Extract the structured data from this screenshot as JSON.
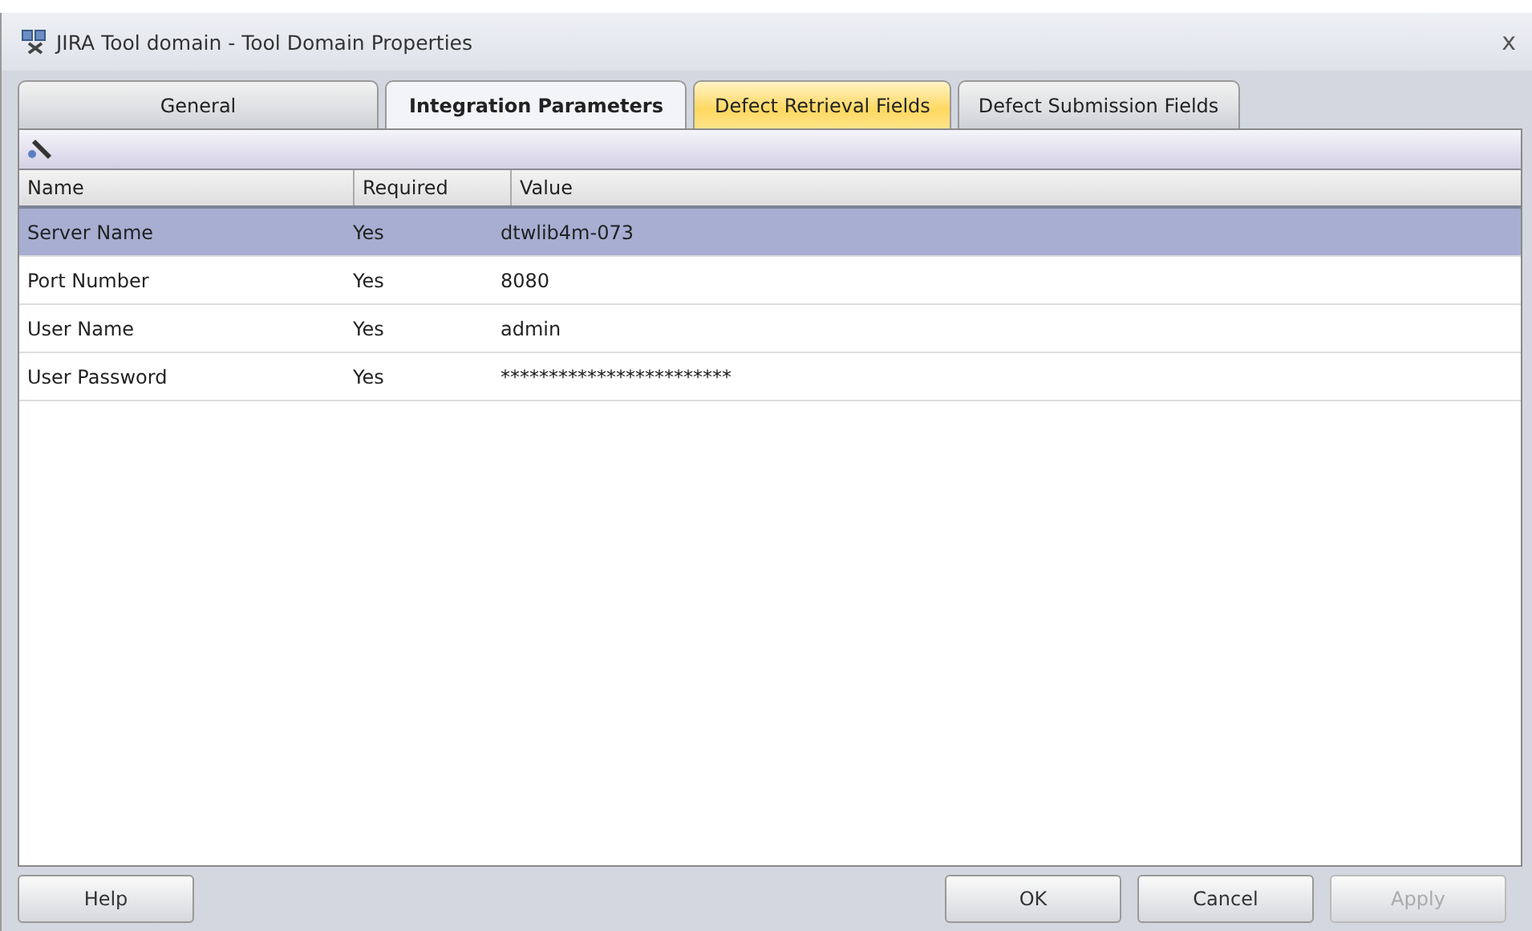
{
  "window": {
    "title": "JIRA Tool domain - Tool Domain Properties",
    "close": "x"
  },
  "tabs": [
    {
      "label": "General",
      "selected": false,
      "hovered": false
    },
    {
      "label": "Integration Parameters",
      "selected": true,
      "hovered": false
    },
    {
      "label": "Defect Retrieval Fields",
      "selected": false,
      "hovered": true
    },
    {
      "label": "Defect Submission Fields",
      "selected": false,
      "hovered": false
    }
  ],
  "table": {
    "columns": [
      "Name",
      "Required",
      "Value"
    ],
    "rows": [
      {
        "cells": [
          "Server Name",
          "Yes",
          "dtwlib4m-073"
        ],
        "selected": true
      },
      {
        "cells": [
          "Port Number",
          "Yes",
          "8080"
        ],
        "selected": false
      },
      {
        "cells": [
          "User Name",
          "Yes",
          "admin"
        ],
        "selected": false
      },
      {
        "cells": [
          "User Password",
          "Yes",
          "************************"
        ],
        "selected": false
      }
    ]
  },
  "help_button": {
    "label": "Help",
    "disabled": false
  },
  "buttons": [
    {
      "label": "OK",
      "disabled": false
    },
    {
      "label": "Cancel",
      "disabled": false
    },
    {
      "label": "Apply",
      "disabled": true
    }
  ]
}
